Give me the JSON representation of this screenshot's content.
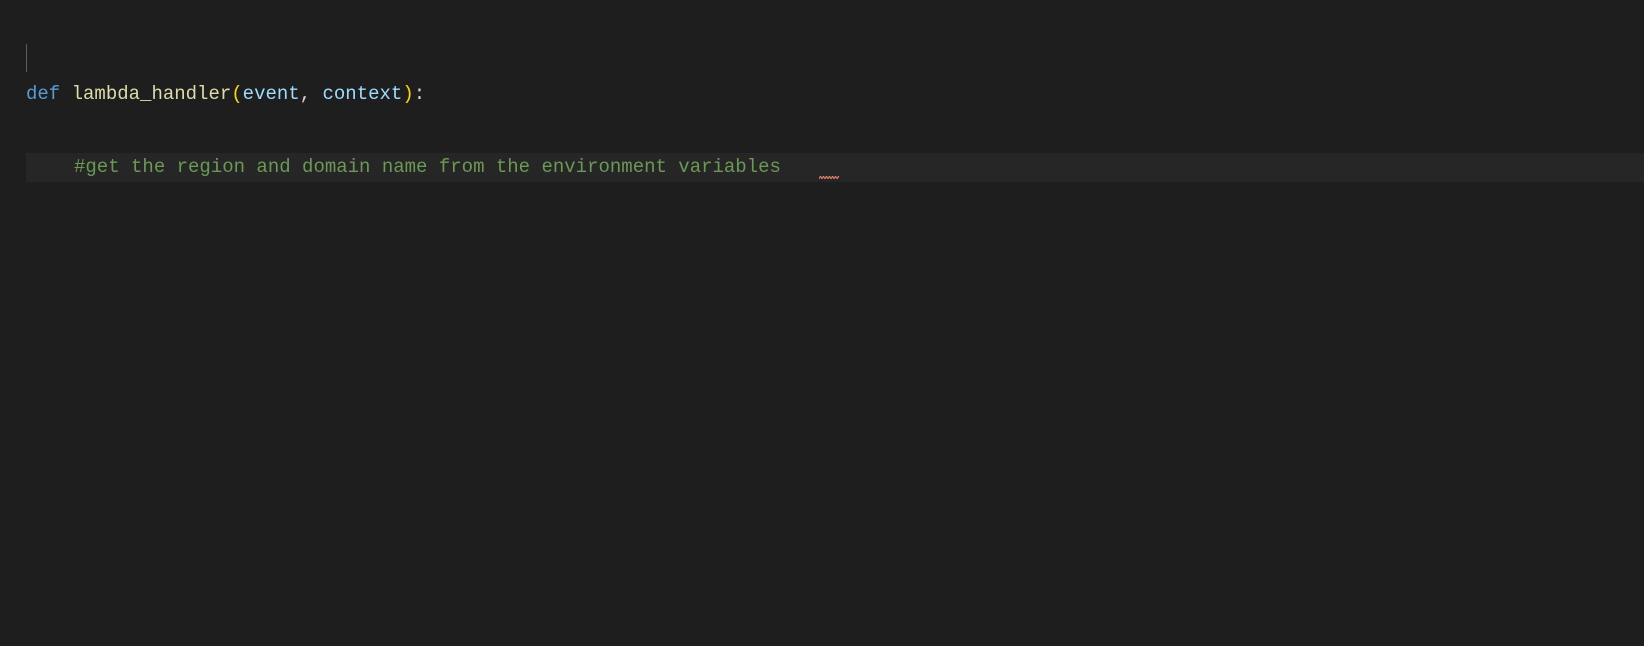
{
  "code": {
    "line1": {
      "keyword_def": "def",
      "space1": " ",
      "function_name": "lambda_handler",
      "paren_open": "(",
      "param1": "event",
      "comma": ",",
      "space2": " ",
      "param2": "context",
      "paren_close": ")",
      "colon": ":"
    },
    "line2": {
      "comment": "#get the region and domain name from the environment variables"
    }
  }
}
